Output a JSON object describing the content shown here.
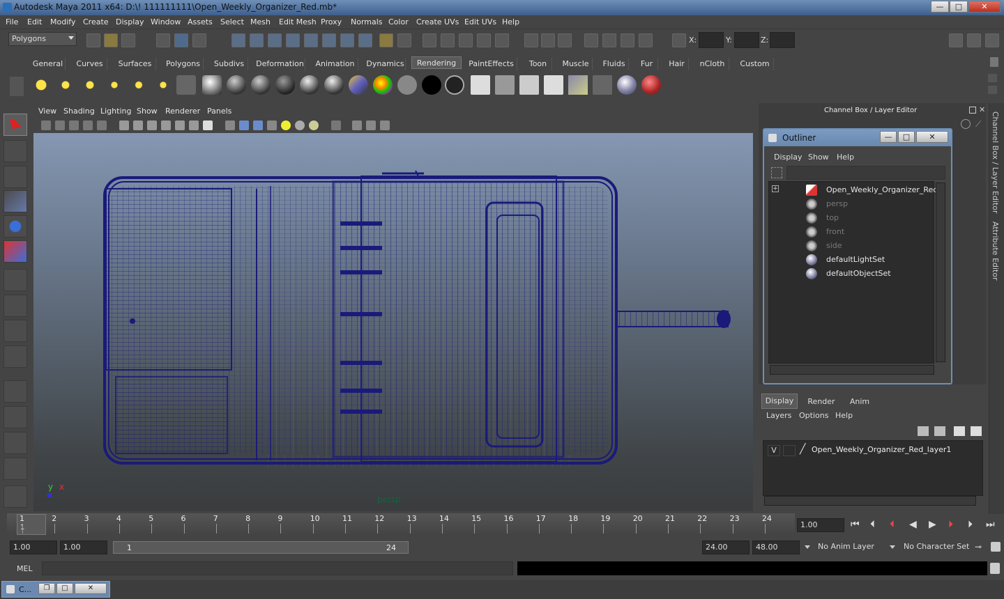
{
  "window": {
    "title": "Autodesk Maya 2011 x64: D:\\! 111111111\\Open_Weekly_Organizer_Red.mb*",
    "min_label": "—",
    "max_label": "□",
    "close_label": "✕"
  },
  "menubar": [
    "File",
    "Edit",
    "Modify",
    "Create",
    "Display",
    "Window",
    "Assets",
    "Select",
    "Mesh",
    "Edit Mesh",
    "Proxy",
    "Normals",
    "Color",
    "Create UVs",
    "Edit UVs",
    "Help"
  ],
  "status": {
    "mode": "Polygons",
    "x_label": "X:",
    "y_label": "Y:",
    "z_label": "Z:"
  },
  "shelf_tabs": [
    "General",
    "Curves",
    "Surfaces",
    "Polygons",
    "Subdivs",
    "Deformation",
    "Animation",
    "Dynamics",
    "Rendering",
    "PaintEffects",
    "Toon",
    "Muscle",
    "Fluids",
    "Fur",
    "Hair",
    "nCloth",
    "Custom"
  ],
  "shelf_active": "Rendering",
  "viewport_menu": [
    "View",
    "Shading",
    "Lighting",
    "Show",
    "Renderer",
    "Panels"
  ],
  "viewport": {
    "camera_label": "persp",
    "axis_y": "y",
    "axis_x": "x"
  },
  "channel_box": {
    "title": "Channel Box / Layer Editor"
  },
  "side_tabs": {
    "channel": "Channel Box / Layer Editor",
    "attribute": "Attribute Editor"
  },
  "outliner": {
    "title": "Outliner",
    "menu": [
      "Display",
      "Show",
      "Help"
    ],
    "items": [
      {
        "label": "Open_Weekly_Organizer_Red",
        "dim": false,
        "icon": "mesh-icon"
      },
      {
        "label": "persp",
        "dim": true,
        "icon": "camera-icon"
      },
      {
        "label": "top",
        "dim": true,
        "icon": "camera-icon"
      },
      {
        "label": "front",
        "dim": true,
        "icon": "camera-icon"
      },
      {
        "label": "side",
        "dim": true,
        "icon": "camera-icon"
      },
      {
        "label": "defaultLightSet",
        "dim": false,
        "icon": "set-icon"
      },
      {
        "label": "defaultObjectSet",
        "dim": false,
        "icon": "set-icon"
      }
    ]
  },
  "layer_editor": {
    "tabs": [
      "Display",
      "Render",
      "Anim"
    ],
    "active_tab": "Display",
    "menu": [
      "Layers",
      "Options",
      "Help"
    ],
    "layer": {
      "visible": "V",
      "name": "Open_Weekly_Organizer_Red_layer1"
    }
  },
  "timeline": {
    "ticks": [
      "1",
      "2",
      "3",
      "4",
      "5",
      "6",
      "7",
      "8",
      "9",
      "10",
      "11",
      "12",
      "13",
      "14",
      "15",
      "16",
      "17",
      "18",
      "19",
      "20",
      "21",
      "22",
      "23",
      "24"
    ],
    "current_marker": "1",
    "current_frame": "1.00"
  },
  "range": {
    "start": "1.00",
    "playback_start": "1.00",
    "slider_start": "1",
    "slider_end": "24",
    "playback_end": "24.00",
    "end": "48.00",
    "anim_layer": "No Anim Layer",
    "character_set": "No Character Set"
  },
  "mel": {
    "label": "MEL"
  },
  "taskbar": {
    "label": "C..."
  },
  "colors": {
    "wire": "#1a1a7a",
    "accent": "#6d8fb8"
  }
}
